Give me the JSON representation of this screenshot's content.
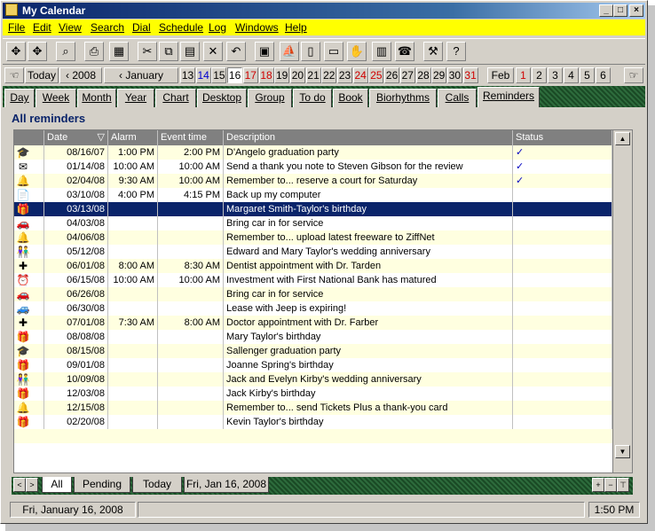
{
  "window": {
    "title": "My Calendar",
    "min": "_",
    "max": "□",
    "close": "×"
  },
  "menu": [
    "File",
    "Edit",
    "View",
    "Search",
    "Dial",
    "Schedule",
    "Log",
    "Windows",
    "Help"
  ],
  "toolbar_icons": [
    "move-icon",
    "move2-icon",
    "search-icon",
    "print-icon",
    "preview-icon",
    "cut-icon",
    "copy-icon",
    "paste-icon",
    "delete-icon",
    "undo-icon",
    "briefcase-icon",
    "ship-icon",
    "note-icon",
    "memo-icon",
    "hand-icon",
    "book-icon",
    "phone-icon",
    "tools-icon",
    "help-icon"
  ],
  "toolbar_glyphs": [
    "✥",
    "✥",
    "⌕",
    "⎙",
    "▦",
    "✂",
    "⧉",
    "▤",
    "✕",
    "↶",
    "▣",
    "⛵",
    "▯",
    "▭",
    "✋",
    "▥",
    "☎",
    "⚒",
    "?"
  ],
  "datebar": {
    "today": "Today",
    "year": "2008",
    "month": "January",
    "days": [
      "13",
      "14",
      "15",
      "16",
      "17",
      "18",
      "19",
      "20",
      "21",
      "22",
      "23",
      "24",
      "25",
      "26",
      "27",
      "28",
      "29",
      "30",
      "31"
    ],
    "next_month": "Feb",
    "next_days": [
      "1",
      "2",
      "3",
      "4",
      "5",
      "6"
    ],
    "selected_day": "16"
  },
  "view_tabs": [
    "Day",
    "Week",
    "Month",
    "Year",
    "Chart",
    "Desktop",
    "Group",
    "To do",
    "Book",
    "Biorhythms",
    "Calls",
    "Reminders"
  ],
  "active_tab": "Reminders",
  "header": {
    "title": "All reminders"
  },
  "columns": {
    "date": "Date",
    "alarm": "Alarm",
    "event_time": "Event time",
    "description": "Description",
    "status": "Status"
  },
  "rows": [
    {
      "icon": "graduation-icon",
      "glyph": "🎓",
      "date": "08/16/07",
      "alarm": "1:00 PM",
      "time": "2:00 PM",
      "desc": "D'Angelo graduation party",
      "status": "✓",
      "done": true
    },
    {
      "icon": "envelope-icon",
      "glyph": "✉",
      "date": "01/14/08",
      "alarm": "10:00 AM",
      "time": "10:00 AM",
      "desc": "Send a thank you note to Steven Gibson for the review",
      "status": "✓",
      "done": true
    },
    {
      "icon": "bell-icon",
      "glyph": "🔔",
      "date": "02/04/08",
      "alarm": "9:30 AM",
      "time": "10:00 AM",
      "desc": "Remember to...  reserve a court for Saturday",
      "status": "✓",
      "done": true
    },
    {
      "icon": "document-icon",
      "glyph": "📄",
      "date": "03/10/08",
      "alarm": "4:00 PM",
      "time": "4:15 PM",
      "desc": "Back up my computer",
      "status": "",
      "done": false
    },
    {
      "icon": "gift-icon",
      "glyph": "🎁",
      "date": "03/13/08",
      "alarm": "",
      "time": "",
      "desc": "Margaret Smith-Taylor's birthday",
      "status": "",
      "done": false,
      "selected": true
    },
    {
      "icon": "car-icon",
      "glyph": "🚗",
      "date": "04/03/08",
      "alarm": "",
      "time": "",
      "desc": "Bring car in for service",
      "status": "",
      "done": false
    },
    {
      "icon": "bell-icon",
      "glyph": "🔔",
      "date": "04/06/08",
      "alarm": "",
      "time": "",
      "desc": "Remember to...  upload latest freeware to ZiffNet",
      "status": "",
      "done": false
    },
    {
      "icon": "couple-icon",
      "glyph": "👫",
      "date": "05/12/08",
      "alarm": "",
      "time": "",
      "desc": "Edward and Mary Taylor's wedding anniversary",
      "status": "",
      "done": false
    },
    {
      "icon": "medical-icon",
      "glyph": "✚",
      "date": "06/01/08",
      "alarm": "8:00 AM",
      "time": "8:30 AM",
      "desc": "Dentist appointment with Dr. Tarden",
      "status": "",
      "done": false
    },
    {
      "icon": "clock-icon",
      "glyph": "⏰",
      "date": "06/15/08",
      "alarm": "10:00 AM",
      "time": "10:00 AM",
      "desc": "Investment with First National Bank has matured",
      "status": "",
      "done": false
    },
    {
      "icon": "car-icon",
      "glyph": "🚗",
      "date": "06/26/08",
      "alarm": "",
      "time": "",
      "desc": "Bring car in for service",
      "status": "",
      "done": false
    },
    {
      "icon": "car-icon",
      "glyph": "🚙",
      "date": "06/30/08",
      "alarm": "",
      "time": "",
      "desc": "Lease with Jeep is expiring!",
      "status": "",
      "done": false
    },
    {
      "icon": "medical-icon",
      "glyph": "✚",
      "date": "07/01/08",
      "alarm": "7:30 AM",
      "time": "8:00 AM",
      "desc": "Doctor appointment with Dr. Farber",
      "status": "",
      "done": false
    },
    {
      "icon": "gift-icon",
      "glyph": "🎁",
      "date": "08/08/08",
      "alarm": "",
      "time": "",
      "desc": "Mary Taylor's birthday",
      "status": "",
      "done": false
    },
    {
      "icon": "graduation-icon",
      "glyph": "🎓",
      "date": "08/15/08",
      "alarm": "",
      "time": "",
      "desc": "Sallenger graduation party",
      "status": "",
      "done": false
    },
    {
      "icon": "gift-icon",
      "glyph": "🎁",
      "date": "09/01/08",
      "alarm": "",
      "time": "",
      "desc": "Joanne Spring's birthday",
      "status": "",
      "done": false
    },
    {
      "icon": "couple-icon",
      "glyph": "👫",
      "date": "10/09/08",
      "alarm": "",
      "time": "",
      "desc": "Jack and  Evelyn Kirby's wedding anniversary",
      "status": "",
      "done": false
    },
    {
      "icon": "gift-icon",
      "glyph": "🎁",
      "date": "12/03/08",
      "alarm": "",
      "time": "",
      "desc": "Jack Kirby's birthday",
      "status": "",
      "done": false
    },
    {
      "icon": "bell-icon",
      "glyph": "🔔",
      "date": "12/15/08",
      "alarm": "",
      "time": "",
      "desc": "Remember to...  send Tickets Plus a thank-you card",
      "status": "",
      "done": false
    },
    {
      "icon": "gift-icon",
      "glyph": "🎁",
      "date": "02/20/08",
      "alarm": "",
      "time": "",
      "desc": "Kevin Taylor's birthday",
      "status": "",
      "done": false
    }
  ],
  "bottom_tabs": [
    "All",
    "Pending",
    "Today",
    "Fri, Jan 16, 2008"
  ],
  "bottom_buttons": [
    "+",
    "−",
    "⊤"
  ],
  "status": {
    "date": "Fri, January 16, 2008",
    "time": "1:50 PM"
  },
  "colors": {
    "menubar": "#ffff00",
    "selection": "#0a246a",
    "red_day": "#d00000",
    "row_tint": "#ffffe0"
  }
}
